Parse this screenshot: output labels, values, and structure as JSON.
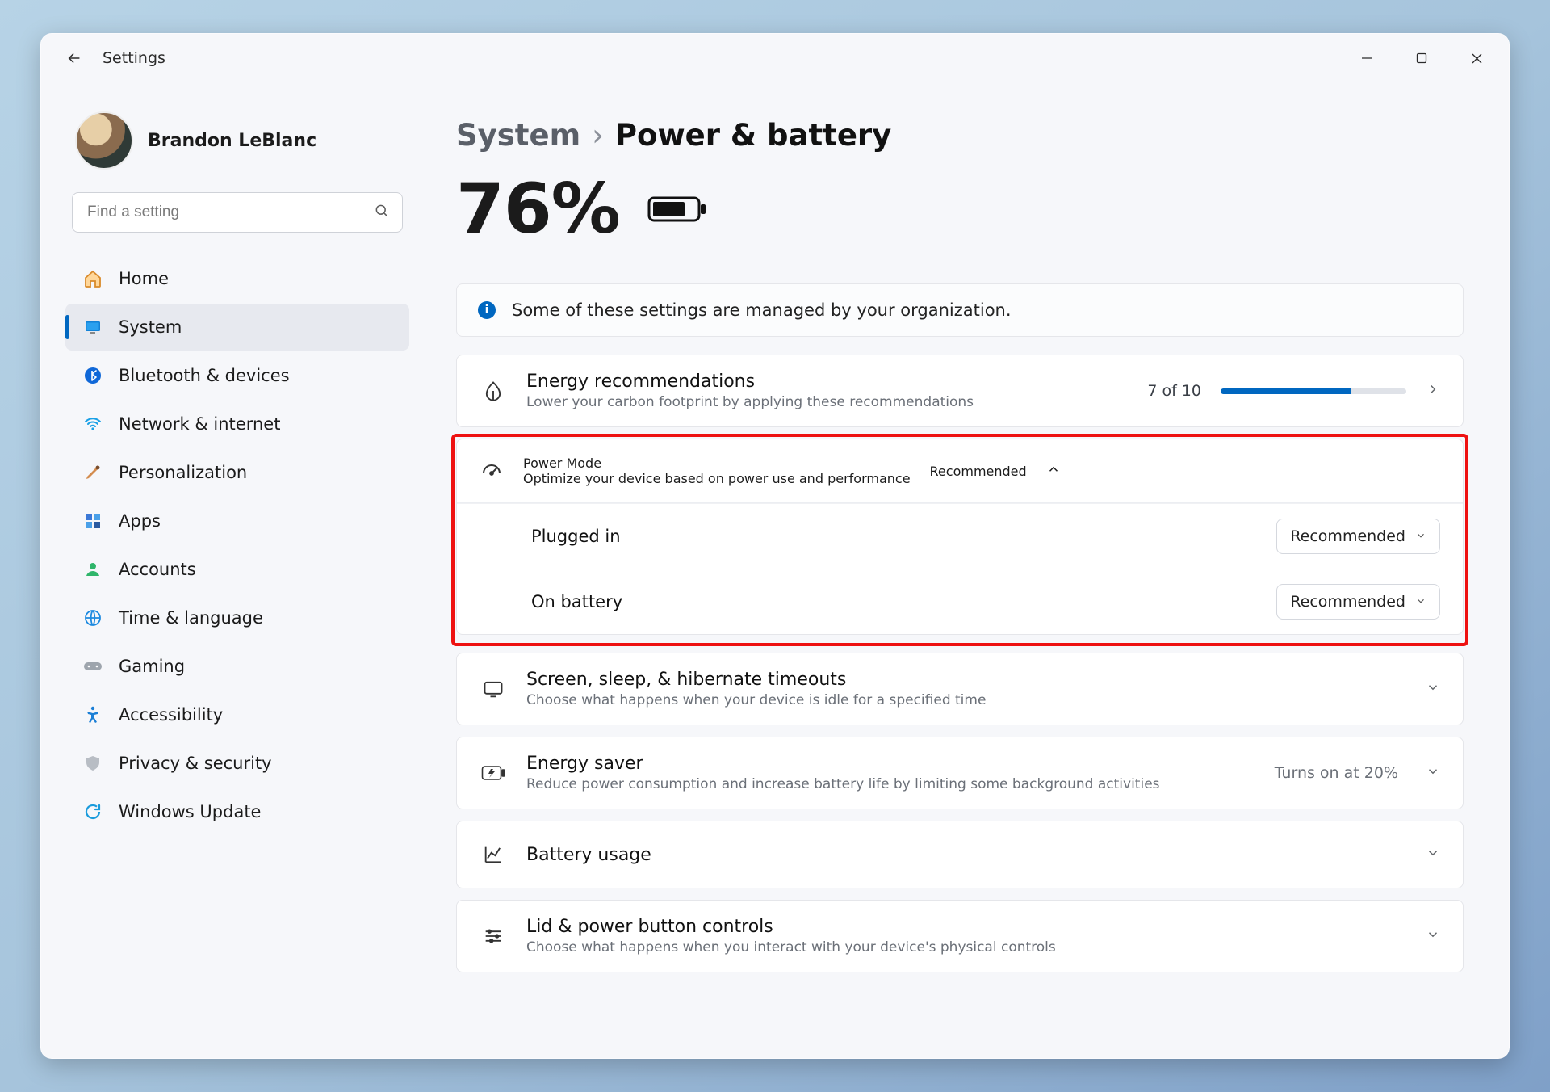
{
  "app": {
    "title": "Settings"
  },
  "user": {
    "name": "Brandon LeBlanc"
  },
  "search": {
    "placeholder": "Find a setting"
  },
  "sidebar": {
    "items": [
      {
        "label": "Home",
        "icon": "home-icon"
      },
      {
        "label": "System",
        "icon": "system-icon",
        "active": true
      },
      {
        "label": "Bluetooth & devices",
        "icon": "bluetooth-icon"
      },
      {
        "label": "Network & internet",
        "icon": "wifi-icon"
      },
      {
        "label": "Personalization",
        "icon": "brush-icon"
      },
      {
        "label": "Apps",
        "icon": "apps-icon"
      },
      {
        "label": "Accounts",
        "icon": "person-icon"
      },
      {
        "label": "Time & language",
        "icon": "globe-icon"
      },
      {
        "label": "Gaming",
        "icon": "gamepad-icon"
      },
      {
        "label": "Accessibility",
        "icon": "accessibility-icon"
      },
      {
        "label": "Privacy & security",
        "icon": "shield-icon"
      },
      {
        "label": "Windows Update",
        "icon": "update-icon"
      }
    ]
  },
  "breadcrumb": {
    "root": "System",
    "separator": "›",
    "leaf": "Power & battery"
  },
  "battery": {
    "percent_label": "76%"
  },
  "banner": {
    "text": "Some of these settings are managed by your organization."
  },
  "energy": {
    "title": "Energy recommendations",
    "desc": "Lower your carbon footprint by applying these recommendations",
    "count": "7 of 10",
    "progress_pct": 70
  },
  "power_mode": {
    "title": "Power Mode",
    "desc": "Optimize your device based on power use and performance",
    "hint": "Recommended",
    "options": [
      {
        "label": "Plugged in",
        "value": "Recommended"
      },
      {
        "label": "On battery",
        "value": "Recommended"
      }
    ]
  },
  "timeouts": {
    "title": "Screen, sleep, & hibernate timeouts",
    "desc": "Choose what happens when your device is idle for a specified time"
  },
  "energy_saver": {
    "title": "Energy saver",
    "desc": "Reduce power consumption and increase battery life by limiting some background activities",
    "hint": "Turns on at 20%"
  },
  "battery_usage": {
    "title": "Battery usage"
  },
  "lid": {
    "title": "Lid & power button controls",
    "desc": "Choose what happens when you interact with your device's physical controls"
  }
}
